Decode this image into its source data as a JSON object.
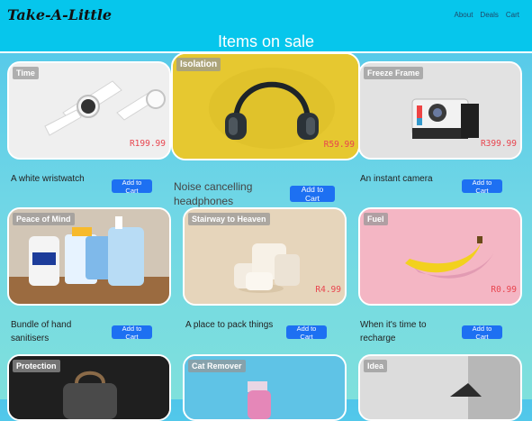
{
  "header": {
    "brand": "Take-A-Little",
    "nav": [
      "About",
      "Deals",
      "Cart"
    ]
  },
  "page_title": "Items on sale",
  "add_to_cart_label": "Add to Cart",
  "products": [
    {
      "badge": "Time",
      "price": "R199.99",
      "description": "A white wristwatch",
      "icon": "wristwatch-photo"
    },
    {
      "badge": "Isolation",
      "price": "R59.99",
      "description": "Noise cancelling headphones",
      "icon": "headphones-photo"
    },
    {
      "badge": "Freeze Frame",
      "price": "R399.99",
      "description": "An instant camera",
      "icon": "camera-photo"
    },
    {
      "badge": "Peace of Mind",
      "price": "",
      "description": "Bundle of hand sanitisers",
      "icon": "sanitiser-photo"
    },
    {
      "badge": "Stairway to Heaven",
      "price": "R4.99",
      "description": "A place to pack things",
      "icon": "stairs-photo"
    },
    {
      "badge": "Fuel",
      "price": "R0.99",
      "description": "When it's time to recharge",
      "icon": "banana-photo"
    },
    {
      "badge": "Protection",
      "price": "",
      "description": "",
      "icon": "backpack-photo"
    },
    {
      "badge": "Cat Remover",
      "price": "",
      "description": "",
      "icon": "spray-bottle-photo"
    },
    {
      "badge": "Idea",
      "price": "",
      "description": "",
      "icon": "lamp-photo"
    }
  ],
  "colors": {
    "navbar": "#06c6ec",
    "button": "#1d70f2",
    "price": "#e8454f"
  }
}
